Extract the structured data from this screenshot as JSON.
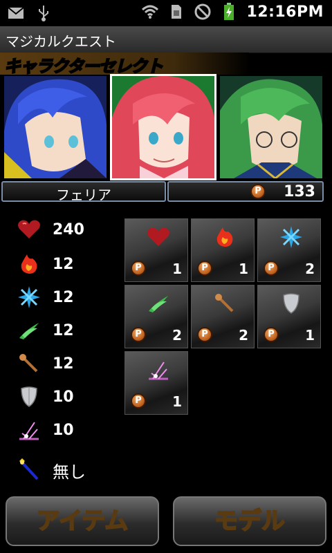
{
  "status": {
    "time": "12:16PM"
  },
  "app": {
    "title": "マジカルクエスト"
  },
  "banner": {
    "text": "キャラクターセレクト"
  },
  "character": {
    "name": "フェリア",
    "points": "133"
  },
  "stats": [
    {
      "icon": "heart-icon",
      "value": "240"
    },
    {
      "icon": "fire-icon",
      "value": "12"
    },
    {
      "icon": "ice-icon",
      "value": "12"
    },
    {
      "icon": "wind-icon",
      "value": "12"
    },
    {
      "icon": "staff-icon",
      "value": "12"
    },
    {
      "icon": "shield-icon",
      "value": "10"
    },
    {
      "icon": "magic-spark-icon",
      "value": "10"
    }
  ],
  "equip": {
    "icon": "wand-icon",
    "value": "無し"
  },
  "items": [
    {
      "icon": "heart-icon",
      "cost": "1"
    },
    {
      "icon": "fire-icon",
      "cost": "1"
    },
    {
      "icon": "ice-icon",
      "cost": "2"
    },
    {
      "icon": "wind-icon",
      "cost": "2"
    },
    {
      "icon": "staff-icon",
      "cost": "2"
    },
    {
      "icon": "shield-icon",
      "cost": "1"
    },
    {
      "icon": "magic-spark-icon",
      "cost": "1"
    }
  ],
  "badge": "P",
  "buttons": {
    "item": "アイテム",
    "model": "モデル"
  }
}
